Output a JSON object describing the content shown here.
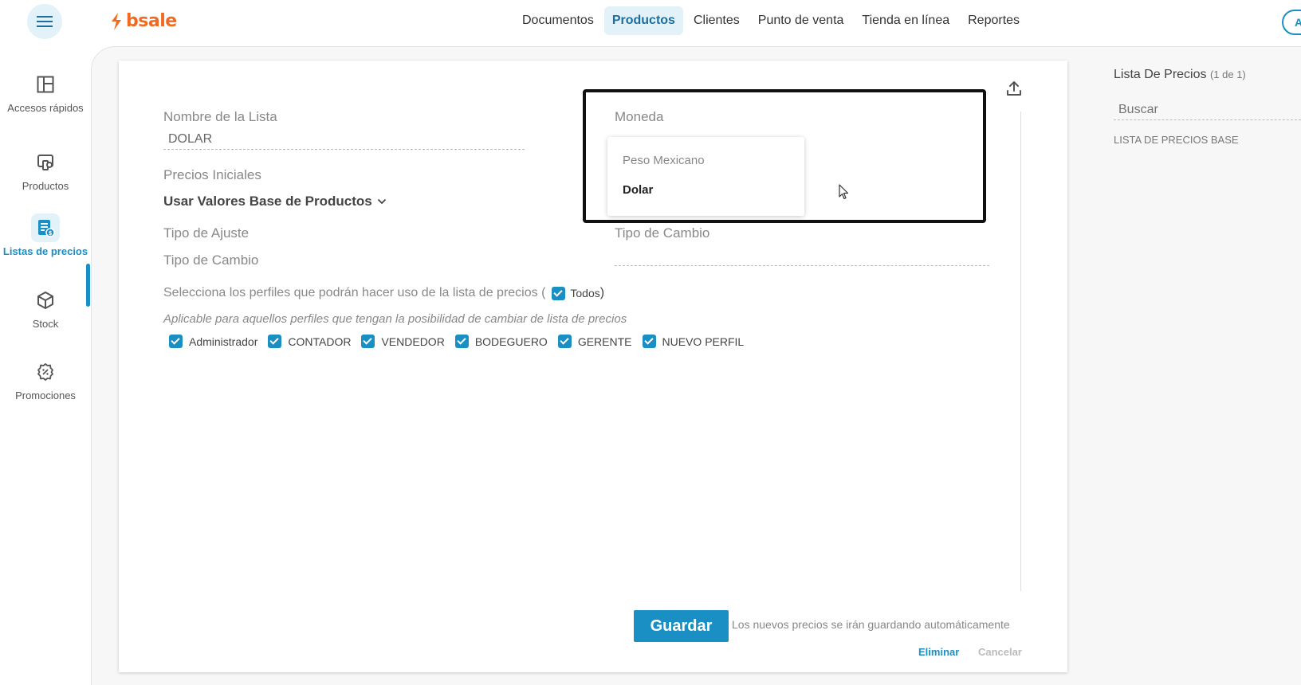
{
  "brand": {
    "name": "bsale",
    "color": "#f26a21"
  },
  "accent_color": "#1a8fc4",
  "nav": {
    "items": [
      {
        "label": "Documentos",
        "active": false
      },
      {
        "label": "Productos",
        "active": true
      },
      {
        "label": "Clientes",
        "active": false
      },
      {
        "label": "Punto de venta",
        "active": false
      },
      {
        "label": "Tienda en línea",
        "active": false
      },
      {
        "label": "Reportes",
        "active": false
      }
    ],
    "help_label": "Ay"
  },
  "sidebar": {
    "items": [
      {
        "label": "Accesos rápidos",
        "icon": "grid-icon"
      },
      {
        "label": "Productos",
        "icon": "products-icon"
      },
      {
        "label": "Listas de precios",
        "icon": "price-list-icon",
        "active": true
      },
      {
        "label": "Stock",
        "icon": "box-icon"
      },
      {
        "label": "Promociones",
        "icon": "discount-badge-icon"
      }
    ]
  },
  "form": {
    "nombre_label": "Nombre de la Lista",
    "nombre_value": "DOLAR",
    "precios_iniciales_label": "Precios Iniciales",
    "precios_iniciales_value": "Usar Valores Base de Productos",
    "tipo_ajuste_label": "Tipo de Ajuste",
    "tipo_cambio_left_label": "Tipo de Cambio",
    "moneda_label": "Moneda",
    "tipo_cambio_right_label": "Tipo de Cambio",
    "perfiles_text": "Selecciona los perfiles que podrán hacer uso de la lista de precios (",
    "todos_label": "Todos",
    "perfiles_close": ")",
    "perfiles_note": "Aplicable para aquellos perfiles que tengan la posibilidad de cambiar de lista de precios",
    "profiles": [
      "Administrador",
      "CONTADOR",
      "VENDEDOR",
      "BODEGUERO",
      "GERENTE",
      "NUEVO PERFIL"
    ]
  },
  "moneda_dropdown": {
    "options": [
      "Peso Mexicano",
      "Dolar"
    ],
    "selected": "Dolar"
  },
  "footer": {
    "save_label": "Guardar",
    "save_note": "Los nuevos precios se irán guardando automáticamente",
    "delete_label": "Eliminar",
    "cancel_label": "Cancelar"
  },
  "right_panel": {
    "title": "Lista De Precios",
    "count": "(1 de 1)",
    "search_placeholder": "Buscar",
    "items": [
      "LISTA DE PRECIOS BASE"
    ]
  }
}
